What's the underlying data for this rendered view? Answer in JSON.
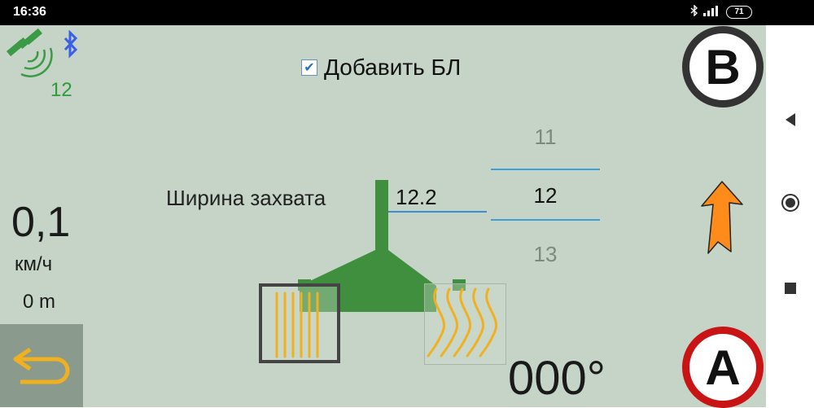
{
  "status_bar": {
    "time": "16:36",
    "battery": "71",
    "icons": [
      "bluetooth-icon",
      "signal-icon",
      "battery-icon"
    ]
  },
  "gps": {
    "satellite_count": "12",
    "colors": {
      "gps": "#2e9a3a",
      "bluetooth": "#3a5fe8"
    }
  },
  "toolbar": {
    "add_bl_label": "Добавить БЛ",
    "add_bl_checked": true
  },
  "buttons": {
    "b_label": "B",
    "a_label": "A"
  },
  "speed": {
    "value": "0,1",
    "unit": "км/ч",
    "distance": "0 m"
  },
  "width_setting": {
    "label": "Ширина захвата",
    "input_value": "12.2",
    "picker": {
      "prev": "11",
      "current": "12",
      "next": "13"
    }
  },
  "heading": {
    "value": "000°"
  },
  "colors": {
    "background": "#c5d4c6",
    "implement": "#3f8f3f",
    "tines": "#f0b020",
    "arrow": "#ff8c1a",
    "a_ring": "#c81414"
  }
}
